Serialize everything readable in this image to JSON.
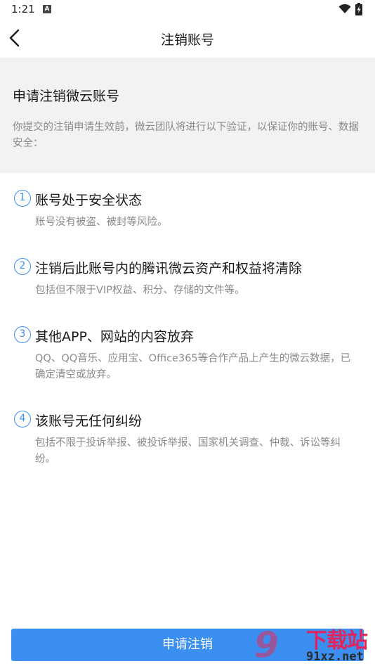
{
  "status_bar": {
    "time": "1:21",
    "notification_badge": "A"
  },
  "nav": {
    "title": "注销账号"
  },
  "intro": {
    "title": "申请注销微云账号",
    "description": "你提交的注销申请生效前，微云团队将进行以下验证，以保证你的账号、数据安全："
  },
  "items": [
    {
      "number": "1",
      "title": "账号处于安全状态",
      "description": "账号没有被盗、被封等风险。"
    },
    {
      "number": "2",
      "title": "注销后此账号内的腾讯微云资产和权益将清除",
      "description": "包括但不限于VIP权益、积分、存储的文件等。"
    },
    {
      "number": "3",
      "title": "其他APP、网站的内容放弃",
      "description": "QQ、QQ音乐、应用宝、Office365等合作产品上产生的微云数据，已确定清空或放弃。"
    },
    {
      "number": "4",
      "title": "该账号无任何纠纷",
      "description": "包括不限于投诉举报、被投诉举报、国家机关调查、仲裁、诉讼等纠纷。"
    }
  ],
  "submit_label": "申请注销",
  "watermark": {
    "logo": "9",
    "text": "下载站",
    "url": "91xz.net"
  },
  "colors": {
    "accent": "#3b8ff0",
    "intro_background": "#f2f2f2",
    "secondary_text": "#8a8a8a"
  }
}
